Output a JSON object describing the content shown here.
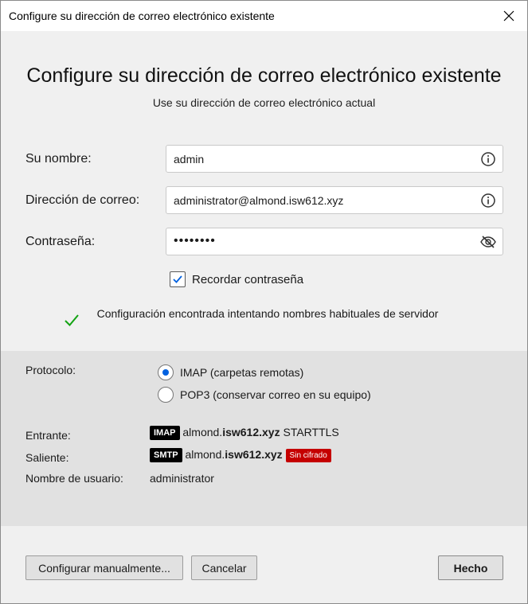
{
  "window": {
    "title": "Configure su dirección de correo electrónico existente"
  },
  "header": {
    "title": "Configure su dirección de correo electrónico existente",
    "subtitle": "Use su dirección de correo electrónico actual"
  },
  "form": {
    "name_label": "Su nombre:",
    "name_value": "admin",
    "email_label": "Dirección de correo:",
    "email_value": "administrator@almond.isw612.xyz",
    "password_label": "Contraseña:",
    "password_value": "••••••••",
    "remember_label": "Recordar contraseña",
    "remember_checked": true
  },
  "status": {
    "message": "Configuración encontrada intentando nombres habituales de servidor"
  },
  "config": {
    "protocol_label": "Protocolo:",
    "protocols": [
      {
        "label": "IMAP (carpetas remotas)",
        "selected": true
      },
      {
        "label": "POP3 (conservar correo en su equipo)",
        "selected": false
      }
    ],
    "incoming_label": "Entrante:",
    "incoming_badge": "IMAP",
    "incoming_host_prefix": "almond.",
    "incoming_host_domain": "isw612.xyz",
    "incoming_security": "STARTTLS",
    "outgoing_label": "Saliente:",
    "outgoing_badge": "SMTP",
    "outgoing_host_prefix": "almond.",
    "outgoing_host_domain": "isw612.xyz",
    "outgoing_security": "Sin cifrado",
    "username_label": "Nombre de usuario:",
    "username_value": "administrator"
  },
  "buttons": {
    "manual": "Configurar manualmente...",
    "cancel": "Cancelar",
    "done": "Hecho"
  },
  "colors": {
    "accent": "#0061e0",
    "success": "#12a312",
    "warning": "#c50000"
  }
}
